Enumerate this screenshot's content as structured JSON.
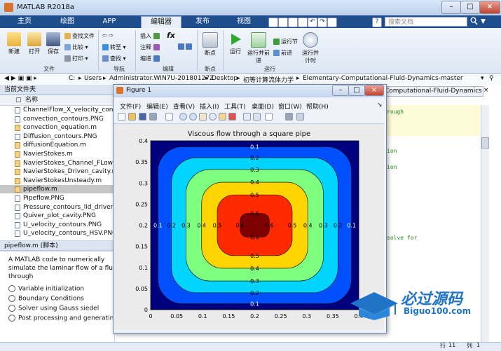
{
  "app": {
    "title": "MATLAB R2018a"
  },
  "tabs": [
    "主页",
    "绘图",
    "APP",
    "编辑器",
    "发布",
    "视图"
  ],
  "search": {
    "placeholder": "搜索文档"
  },
  "ribbon": {
    "file": {
      "label": "文件",
      "new": "新建",
      "open": "打开",
      "save": "保存",
      "find_file": "查找文件",
      "compare": "比较",
      "print": "打印"
    },
    "nav": {
      "label": "导航",
      "goto": "转至",
      "find": "查找"
    },
    "edit": {
      "label": "编辑",
      "insert": "插入",
      "comment": "注释",
      "indent": "缩进",
      "fx": "fx"
    },
    "breakpoints": {
      "label": "断点",
      "button": "断点"
    },
    "run": {
      "label": "运行",
      "run": "运行",
      "run_advance": "运行并前进",
      "run_section": "运行节",
      "advance": "前进",
      "run_time": "运行并计时"
    }
  },
  "address": {
    "drive": "C:",
    "parts": [
      "Users",
      "Administrator.WIN7U-20180127Z",
      "Desktop",
      "初等计算流体力学",
      "Elementary-Computational-Fluid-Dynamics-master"
    ]
  },
  "current_folder": {
    "header": "当前文件夹",
    "column": "名称",
    "files": [
      {
        "name": "ChannelFlow_X_velocity_contours",
        "type": "png"
      },
      {
        "name": "convection_contours.PNG",
        "type": "png"
      },
      {
        "name": "convection_equation.m",
        "type": "m"
      },
      {
        "name": "Diffusion_contours.PNG",
        "type": "png"
      },
      {
        "name": "diffusionEquation.m",
        "type": "m"
      },
      {
        "name": "NavierStokes.m",
        "type": "m"
      },
      {
        "name": "NavierStokes_Channel_FLow.m",
        "type": "m"
      },
      {
        "name": "NavierStokes_Driven_cavity.m",
        "type": "m"
      },
      {
        "name": "NavierStokesUnsteady.m",
        "type": "m"
      },
      {
        "name": "pipeflow.m",
        "type": "m",
        "selected": true
      },
      {
        "name": "Pipeflow.PNG",
        "type": "png"
      },
      {
        "name": "Pressure_contours_lid_driven_cav",
        "type": "png"
      },
      {
        "name": "Quiver_plot_cavity.PNG",
        "type": "png"
      },
      {
        "name": "U_velocity_contours.PNG",
        "type": "png"
      },
      {
        "name": "U_velocity_contours_HSV.PNG",
        "type": "png"
      }
    ]
  },
  "details": {
    "title": "pipeflow.m (脚本)",
    "description": [
      "A MATLAB code to numerically",
      "simulate the laminar flow of a fluid",
      "through"
    ],
    "bullets": [
      "Variable initialization",
      "Boundary Conditions",
      "Solver using Gauss siedel",
      "Post processing and generating t"
    ]
  },
  "editor": {
    "tab_title": "Computational-Fluid-Dynamics",
    "snippets": [
      "rough",
      "ion",
      "ion",
      "solve for"
    ]
  },
  "statusbar": {
    "row_label": "行",
    "row": "11",
    "col_label": "列",
    "col": "1"
  },
  "figure": {
    "title": "Figure 1",
    "menus": [
      "文件(F)",
      "编辑(E)",
      "查看(V)",
      "插入(I)",
      "工具(T)",
      "桌面(D)",
      "窗口(W)",
      "帮助(H)"
    ]
  },
  "chart_data": {
    "type": "heatmap",
    "subtype": "filled-contour",
    "title": "Viscous flow through a square pipe",
    "xlim": [
      0,
      0.4
    ],
    "ylim": [
      0,
      0.4
    ],
    "xticks": [
      0,
      0.05,
      0.1,
      0.15,
      0.2,
      0.25,
      0.3,
      0.35,
      0.4
    ],
    "yticks": [
      0,
      0.05,
      0.1,
      0.15,
      0.2,
      0.25,
      0.3,
      0.35,
      0.4
    ],
    "levels": [
      0,
      0.1,
      0.2,
      0.3,
      0.4,
      0.5,
      0.6,
      0.7
    ],
    "level_labels": [
      "0.1",
      "0.2",
      "0.3",
      "0.4",
      "0.5",
      "0.6"
    ],
    "colors": [
      "#00007f",
      "#0050ff",
      "#00d4ff",
      "#7fff7f",
      "#ffd400",
      "#ff2a00",
      "#7f0000"
    ],
    "grid": false
  },
  "watermark": {
    "cn": "必过源码",
    "en": "Biguo100.com"
  }
}
